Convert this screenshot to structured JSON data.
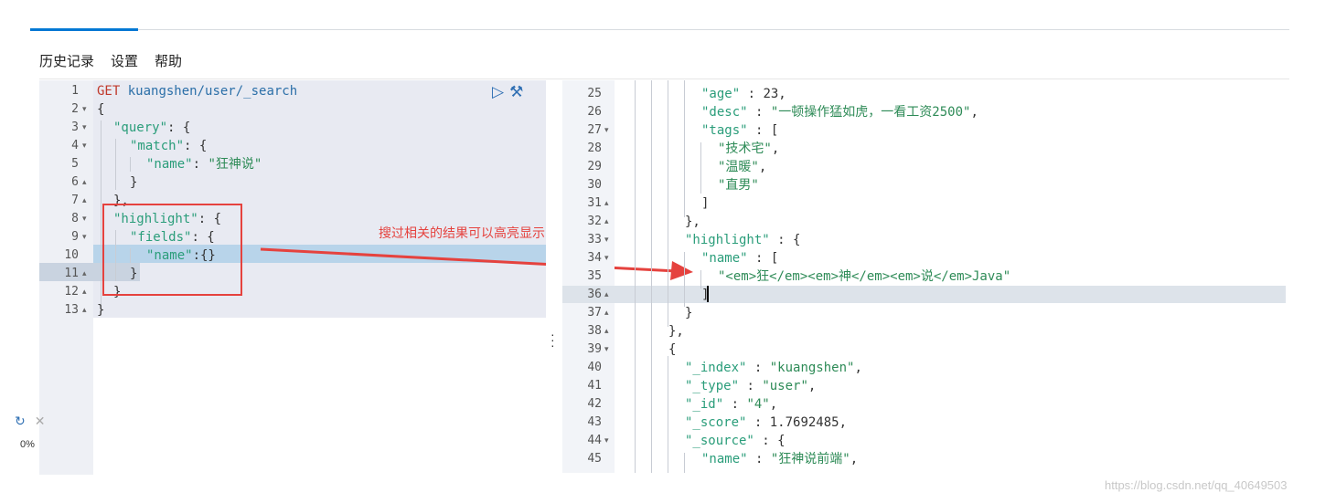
{
  "menu": [
    "历史记录",
    "设置",
    "帮助"
  ],
  "annotation": "搜过相关的结果可以高亮显示",
  "watermark": "https://blog.csdn.net/qq_40649503",
  "side": {
    "percent": "0%"
  },
  "left": {
    "lines": [
      {
        "n": "1",
        "fold": ""
      },
      {
        "n": "2",
        "fold": "▾"
      },
      {
        "n": "3",
        "fold": "▾"
      },
      {
        "n": "4",
        "fold": "▾"
      },
      {
        "n": "5",
        "fold": ""
      },
      {
        "n": "6",
        "fold": "▴"
      },
      {
        "n": "7",
        "fold": "▴"
      },
      {
        "n": "8",
        "fold": "▾"
      },
      {
        "n": "9",
        "fold": "▾"
      },
      {
        "n": "10",
        "fold": ""
      },
      {
        "n": "11",
        "fold": "▴"
      },
      {
        "n": "12",
        "fold": "▴"
      },
      {
        "n": "13",
        "fold": "▴"
      }
    ],
    "request": {
      "verb": "GET",
      "url": "kuangshen/user/_search",
      "open": "{",
      "query_key": "\"query\"",
      "query_rest": ": {",
      "match_key": "\"match\"",
      "match_rest": ": {",
      "name_key": "\"name\"",
      "name_colon": ": ",
      "name_val": "\"狂神说\"",
      "close_match": "}",
      "close_query": "},",
      "highlight_key": "\"highlight\"",
      "highlight_rest": ": {",
      "fields_key": "\"fields\"",
      "fields_rest": ": {",
      "hname_key": "\"name\"",
      "hname_rest": ":{}",
      "close_fields": "}",
      "close_highlight": "}",
      "close_root": "}"
    }
  },
  "right": {
    "lines": [
      {
        "n": "25",
        "fold": ""
      },
      {
        "n": "26",
        "fold": ""
      },
      {
        "n": "27",
        "fold": "▾"
      },
      {
        "n": "28",
        "fold": ""
      },
      {
        "n": "29",
        "fold": ""
      },
      {
        "n": "30",
        "fold": ""
      },
      {
        "n": "31",
        "fold": "▴"
      },
      {
        "n": "32",
        "fold": "▴"
      },
      {
        "n": "33",
        "fold": "▾"
      },
      {
        "n": "34",
        "fold": "▾"
      },
      {
        "n": "35",
        "fold": ""
      },
      {
        "n": "36",
        "fold": "▴"
      },
      {
        "n": "37",
        "fold": "▴"
      },
      {
        "n": "38",
        "fold": "▴"
      },
      {
        "n": "39",
        "fold": "▾"
      },
      {
        "n": "40",
        "fold": ""
      },
      {
        "n": "41",
        "fold": ""
      },
      {
        "n": "42",
        "fold": ""
      },
      {
        "n": "43",
        "fold": ""
      },
      {
        "n": "44",
        "fold": "▾"
      },
      {
        "n": "45",
        "fold": ""
      }
    ],
    "response": {
      "age_key": "\"age\"",
      "age_rest": " : 23,",
      "desc_key": "\"desc\"",
      "desc_colon": " : ",
      "desc_val": "\"一顿操作猛如虎，一看工资2500\"",
      "desc_comma": ",",
      "tags_key": "\"tags\"",
      "tags_rest": " : [",
      "tag1": "\"技术宅\"",
      "tag1c": ",",
      "tag2": "\"温暖\"",
      "tag2c": ",",
      "tag3": "\"直男\"",
      "close_tags": "]",
      "close_source": "},",
      "hl_key": "\"highlight\"",
      "hl_rest": " : {",
      "hlname_key": "\"name\"",
      "hlname_rest": " : [",
      "hl_val": "\"<em>狂</em><em>神</em><em>说</em>Java\"",
      "close_arr": "]",
      "close_hl": "}",
      "close_hit": "},",
      "open_hit": "{",
      "index_key": "\"_index\"",
      "index_colon": " : ",
      "index_val": "\"kuangshen\"",
      "index_comma": ",",
      "type_key": "\"_type\"",
      "type_colon": " : ",
      "type_val": "\"user\"",
      "type_comma": ",",
      "id_key": "\"_id\"",
      "id_colon": " : ",
      "id_val": "\"4\"",
      "id_comma": ",",
      "score_key": "\"_score\"",
      "score_rest": " : 1.7692485,",
      "source_key": "\"_source\"",
      "source_rest": " : {",
      "sname_key": "\"name\"",
      "sname_colon": " : ",
      "sname_val": "\"狂神说前端\"",
      "sname_comma": ","
    }
  }
}
